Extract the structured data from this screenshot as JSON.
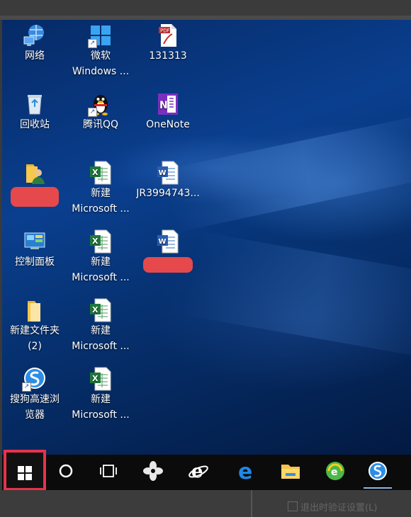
{
  "desktop": {
    "icons": [
      {
        "name": "network",
        "label": "网络",
        "label2": "",
        "icon": "network-icon",
        "redacted": false
      },
      {
        "name": "windows-shortcut",
        "label": "微软",
        "label2": "Windows ...",
        "icon": "windows-logo-icon",
        "redacted": false
      },
      {
        "name": "pdf-file",
        "label": "131313",
        "label2": "",
        "icon": "pdf-icon",
        "redacted": false
      },
      {
        "name": "recycle-bin",
        "label": "回收站",
        "label2": "",
        "icon": "recycle-bin-icon",
        "redacted": false
      },
      {
        "name": "tencent-qq",
        "label": "腾讯QQ",
        "label2": "",
        "icon": "qq-penguin-icon",
        "redacted": false
      },
      {
        "name": "onenote",
        "label": "OneNote",
        "label2": "",
        "icon": "onenote-icon",
        "redacted": false
      },
      {
        "name": "user-folder",
        "label": "",
        "label2": "",
        "icon": "user-folder-icon",
        "redacted": true
      },
      {
        "name": "excel-file-1",
        "label": "新建",
        "label2": "Microsoft ...",
        "icon": "excel-icon",
        "redacted": false
      },
      {
        "name": "word-file-jr",
        "label": "JR3994743...",
        "label2": "",
        "icon": "word-icon",
        "redacted": false
      },
      {
        "name": "control-panel",
        "label": "控制面板",
        "label2": "",
        "icon": "control-panel-icon",
        "redacted": false
      },
      {
        "name": "excel-file-2",
        "label": "新建",
        "label2": "Microsoft ...",
        "icon": "excel-icon",
        "redacted": false
      },
      {
        "name": "word-file-redacted",
        "label": "",
        "label2": "",
        "icon": "word-icon",
        "redacted": true
      },
      {
        "name": "new-folder",
        "label": "新建文件夹",
        "label2": "(2)",
        "icon": "folder-icon",
        "redacted": false
      },
      {
        "name": "excel-file-3",
        "label": "新建",
        "label2": "Microsoft ...",
        "icon": "excel-icon",
        "redacted": false
      },
      {
        "name": "sogou-browser",
        "label": "搜狗高速浏",
        "label2": "览器",
        "icon": "sogou-browser-icon",
        "redacted": false
      },
      {
        "name": "excel-file-4",
        "label": "新建",
        "label2": "Microsoft ...",
        "icon": "excel-icon",
        "redacted": false
      }
    ]
  },
  "taskbar": {
    "items": [
      "start-windows-icon",
      "cortana-search-icon",
      "task-view-icon",
      "fan-app-icon",
      "ie-browser-icon",
      "edge-browser-icon",
      "file-explorer-icon",
      "360-browser-icon",
      "sogou-browser-icon"
    ]
  },
  "background_window": {
    "checkbox_label": "退出时验证设置(L)"
  },
  "colors": {
    "highlight": "#e5334a",
    "redaction": "#e5494c",
    "taskbar": "#0b0b0b"
  }
}
